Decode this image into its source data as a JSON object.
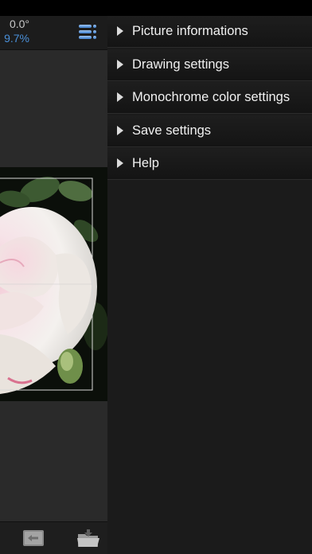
{
  "readouts": {
    "angle": "0.0°",
    "percent": "9.7%"
  },
  "menu": {
    "items": [
      {
        "label": "Picture informations"
      },
      {
        "label": "Drawing settings"
      },
      {
        "label": "Monochrome color settings"
      },
      {
        "label": "Save settings"
      },
      {
        "label": "Help"
      }
    ]
  },
  "icons": {
    "menu": "list-menu-icon",
    "footer_left": "swap-arrows-icon",
    "footer_right": "open-folder-icon",
    "expand": "triangle-right-icon"
  },
  "colors": {
    "accent": "#4a90d9",
    "panel_bg": "#1b1b1b",
    "text": "#f0f0f0"
  }
}
